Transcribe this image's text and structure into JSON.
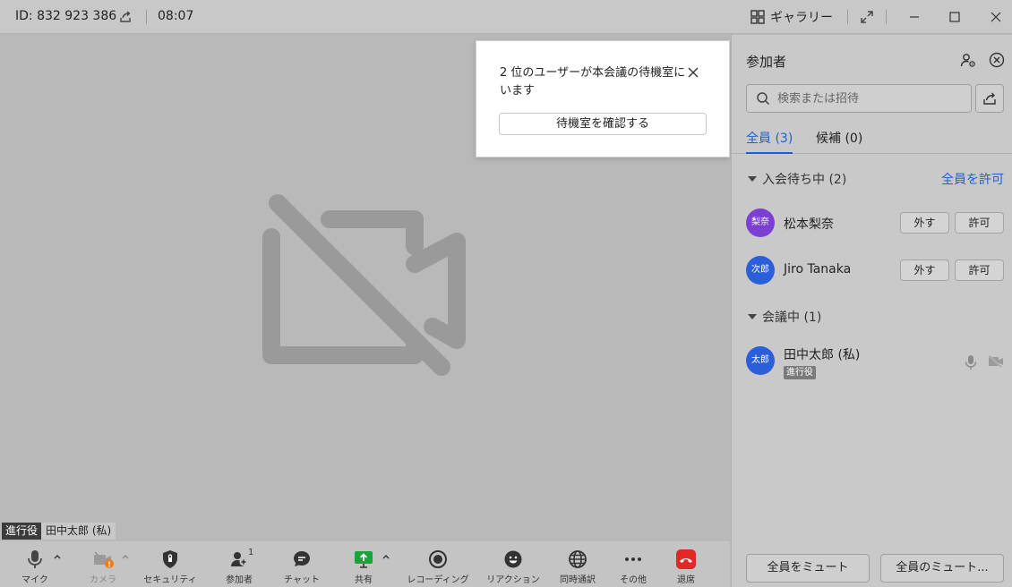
{
  "titlebar": {
    "meeting_id": "ID: 832 923 386",
    "time": "08:07",
    "gallery_label": "ギャラリー"
  },
  "video": {
    "name_tag": {
      "role": "進行役",
      "name": "田中太郎 (私)"
    }
  },
  "waiting_popup": {
    "message": "2 位のユーザーが本会議の待機室にいます",
    "button": "待機室を確認する"
  },
  "toolbar": {
    "items": [
      {
        "icon": "microphone-icon",
        "label": "マイク"
      },
      {
        "icon": "camera-off-icon",
        "label": "カメラ"
      },
      {
        "icon": "shield-icon",
        "label": "セキュリティ"
      },
      {
        "icon": "participants-icon",
        "label": "参加者",
        "badge": "1"
      },
      {
        "icon": "chat-icon",
        "label": "チャット"
      },
      {
        "icon": "share-screen-icon",
        "label": "共有"
      },
      {
        "icon": "record-icon",
        "label": "レコーディング"
      },
      {
        "icon": "reaction-icon",
        "label": "リアクション"
      },
      {
        "icon": "globe-icon",
        "label": "同時通訳"
      },
      {
        "icon": "more-icon",
        "label": "その他"
      },
      {
        "icon": "leave-icon",
        "label": "退席"
      }
    ]
  },
  "sidebar": {
    "title": "参加者",
    "search_placeholder": "検索または招待",
    "tabs": [
      {
        "label": "全員 (3)",
        "active": true
      },
      {
        "label": "候補 (0)",
        "active": false
      }
    ],
    "waiting_section": {
      "label": "入会待ち中 (2)",
      "admit_all": "全員を許可",
      "people": [
        {
          "avatar_text": "梨奈",
          "avatar_color": "#7b3fd1",
          "name": "松本梨奈",
          "remove_label": "外す",
          "admit_label": "許可"
        },
        {
          "avatar_text": "次郎",
          "avatar_color": "#2a5fd9",
          "name": "Jiro Tanaka",
          "remove_label": "外す",
          "admit_label": "許可"
        }
      ]
    },
    "in_meeting_section": {
      "label": "会議中 (1)",
      "people": [
        {
          "avatar_text": "太郎",
          "avatar_color": "#2a5fd9",
          "name": "田中太郎 (私)",
          "badge": "進行役"
        }
      ]
    },
    "mute_all_label": "全員をミュート",
    "unmute_all_label": "全員のミュート..."
  },
  "colors": {
    "accent": "#1e5fd3",
    "leave_red": "#e02828",
    "share_green": "#1aa33a"
  }
}
